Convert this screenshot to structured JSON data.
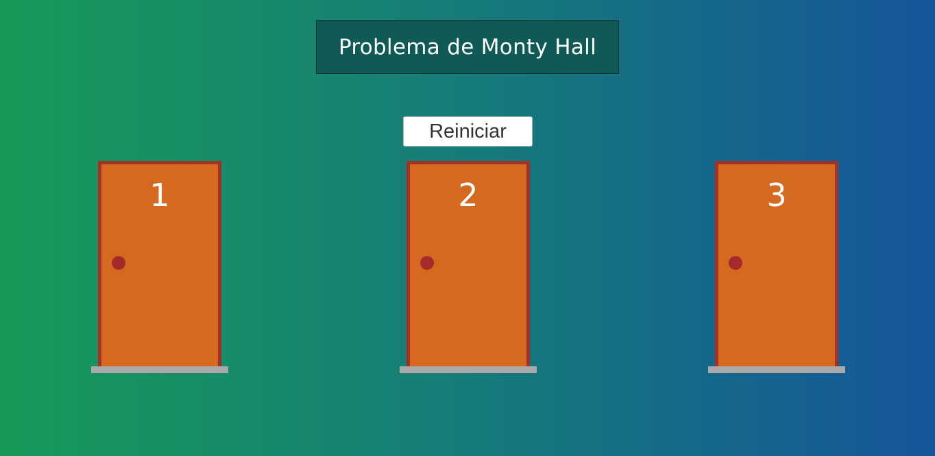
{
  "header": {
    "title": "Problema de Monty Hall"
  },
  "controls": {
    "reset_label": "Reiniciar"
  },
  "doors": [
    {
      "number": "1"
    },
    {
      "number": "2"
    },
    {
      "number": "3"
    }
  ],
  "colors": {
    "door_fill": "#d5691f",
    "door_frame": "#a5302a",
    "door_knob": "#a52a2a",
    "door_step": "#a9a9a9",
    "title_background": "#0f5a57"
  }
}
